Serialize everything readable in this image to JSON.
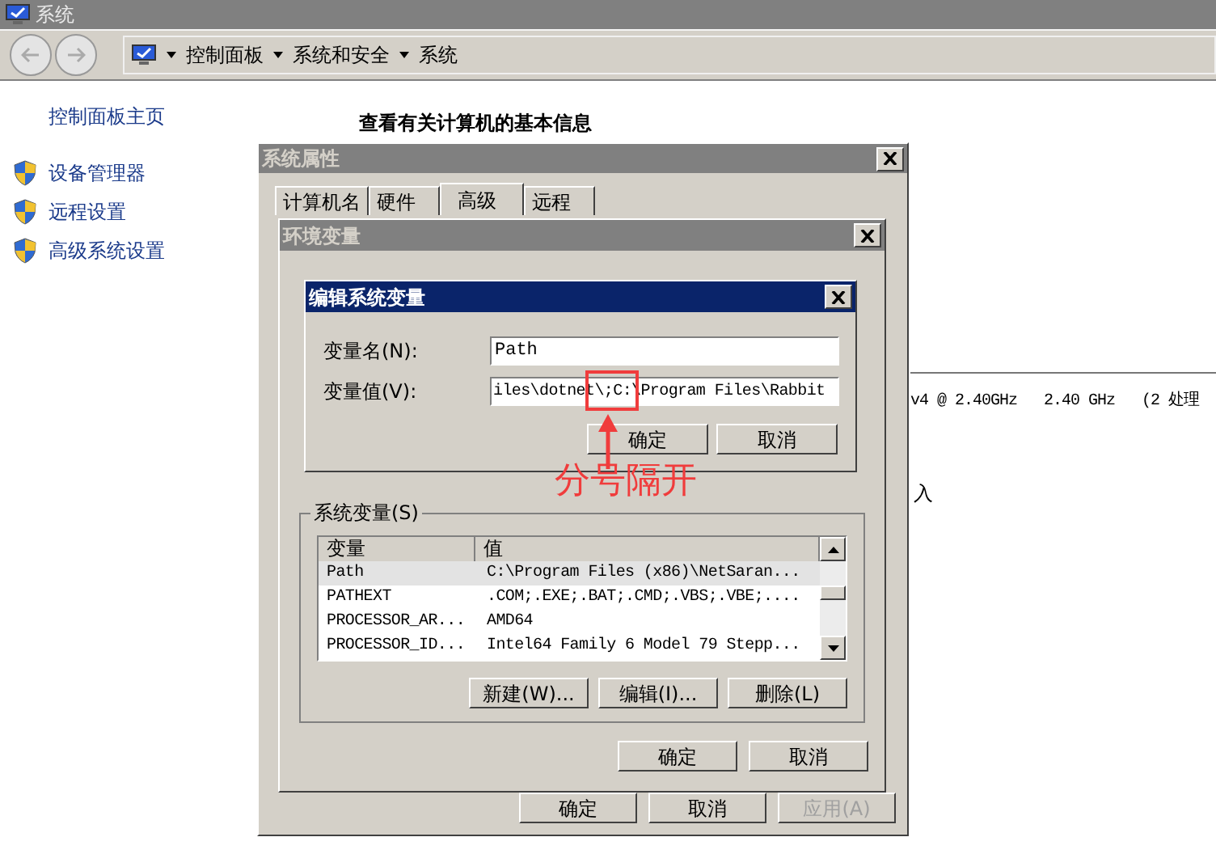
{
  "window": {
    "title": "系统"
  },
  "breadcrumbs": [
    "控制面板",
    "系统和安全",
    "系统"
  ],
  "sidebar": {
    "home": "控制面板主页",
    "items": [
      "设备管理器",
      "远程设置",
      "高级系统设置"
    ]
  },
  "heading": "查看有关计算机的基本信息",
  "processor_text": "v4 @ 2.40GHz   2.40 GHz   (2 处理",
  "partial_text": "入",
  "system_properties": {
    "title": "系统属性",
    "tabs": [
      {
        "label": "计算机名",
        "selected": false
      },
      {
        "label": "硬件",
        "selected": false
      },
      {
        "label": "高级",
        "selected": true
      },
      {
        "label": "远程",
        "selected": false
      }
    ],
    "buttons": [
      {
        "label": "确定",
        "disabled": false
      },
      {
        "label": "取消",
        "disabled": false
      },
      {
        "label": "应用(A)",
        "disabled": true
      }
    ]
  },
  "environment_dialog": {
    "title": "环境变量",
    "group_label": "系统变量(S)",
    "columns": [
      "变量",
      "值"
    ],
    "rows": [
      {
        "name": "Path",
        "value": "C:\\Program Files (x86)\\NetSaran...",
        "selected": true
      },
      {
        "name": "PATHEXT",
        "value": ".COM;.EXE;.BAT;.CMD;.VBS;.VBE;....",
        "selected": false
      },
      {
        "name": "PROCESSOR_AR...",
        "value": "AMD64",
        "selected": false
      },
      {
        "name": "PROCESSOR_ID...",
        "value": "Intel64 Family 6 Model 79 Stepp...",
        "selected": false
      }
    ],
    "list_buttons": [
      "新建(W)...",
      "编辑(I)...",
      "删除(L)"
    ],
    "buttons": [
      "确定",
      "取消"
    ]
  },
  "edit_dialog": {
    "title": "编辑系统变量",
    "name_label": "变量名(N):",
    "name_value": "Path",
    "value_label": "变量值(V):",
    "value_value": "iles\\dotnet\\;C:\\Program Files\\Rabbit",
    "buttons": [
      "确定",
      "取消"
    ]
  },
  "annotation": {
    "text": "分号隔开"
  }
}
